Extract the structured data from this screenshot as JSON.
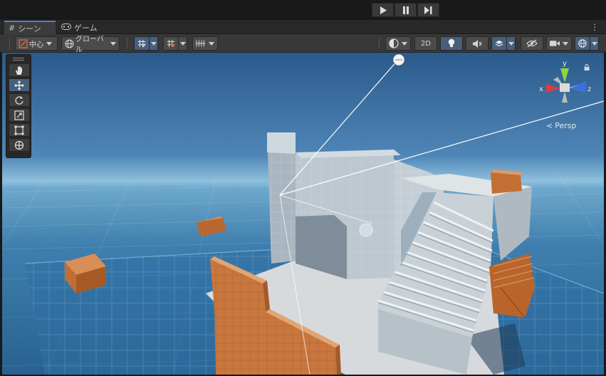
{
  "tabs": [
    {
      "label": "シーン",
      "icon": "grid-icon",
      "active": true
    },
    {
      "label": "ゲーム",
      "icon": "gamepad-icon",
      "active": false
    }
  ],
  "toolbar": {
    "pivot_label": "中心",
    "space_label": "グローバル",
    "mode_2d_label": "2D"
  },
  "gizmo": {
    "axis_y": "y",
    "axis_x": "x",
    "axis_z": "z",
    "projection_label": "Persp"
  },
  "colors": {
    "accent": "#4c7fd1",
    "active_button": "#46607c",
    "sky_top": "#2f5f90",
    "sky_horizon": "#8fc0dd",
    "ground": "#2e6d9f",
    "wall": "#b9c4cc",
    "orange_block": "#c9773e",
    "axis_x": "#e23b3b",
    "axis_y": "#8fd53f",
    "axis_z": "#3d6fe0"
  }
}
